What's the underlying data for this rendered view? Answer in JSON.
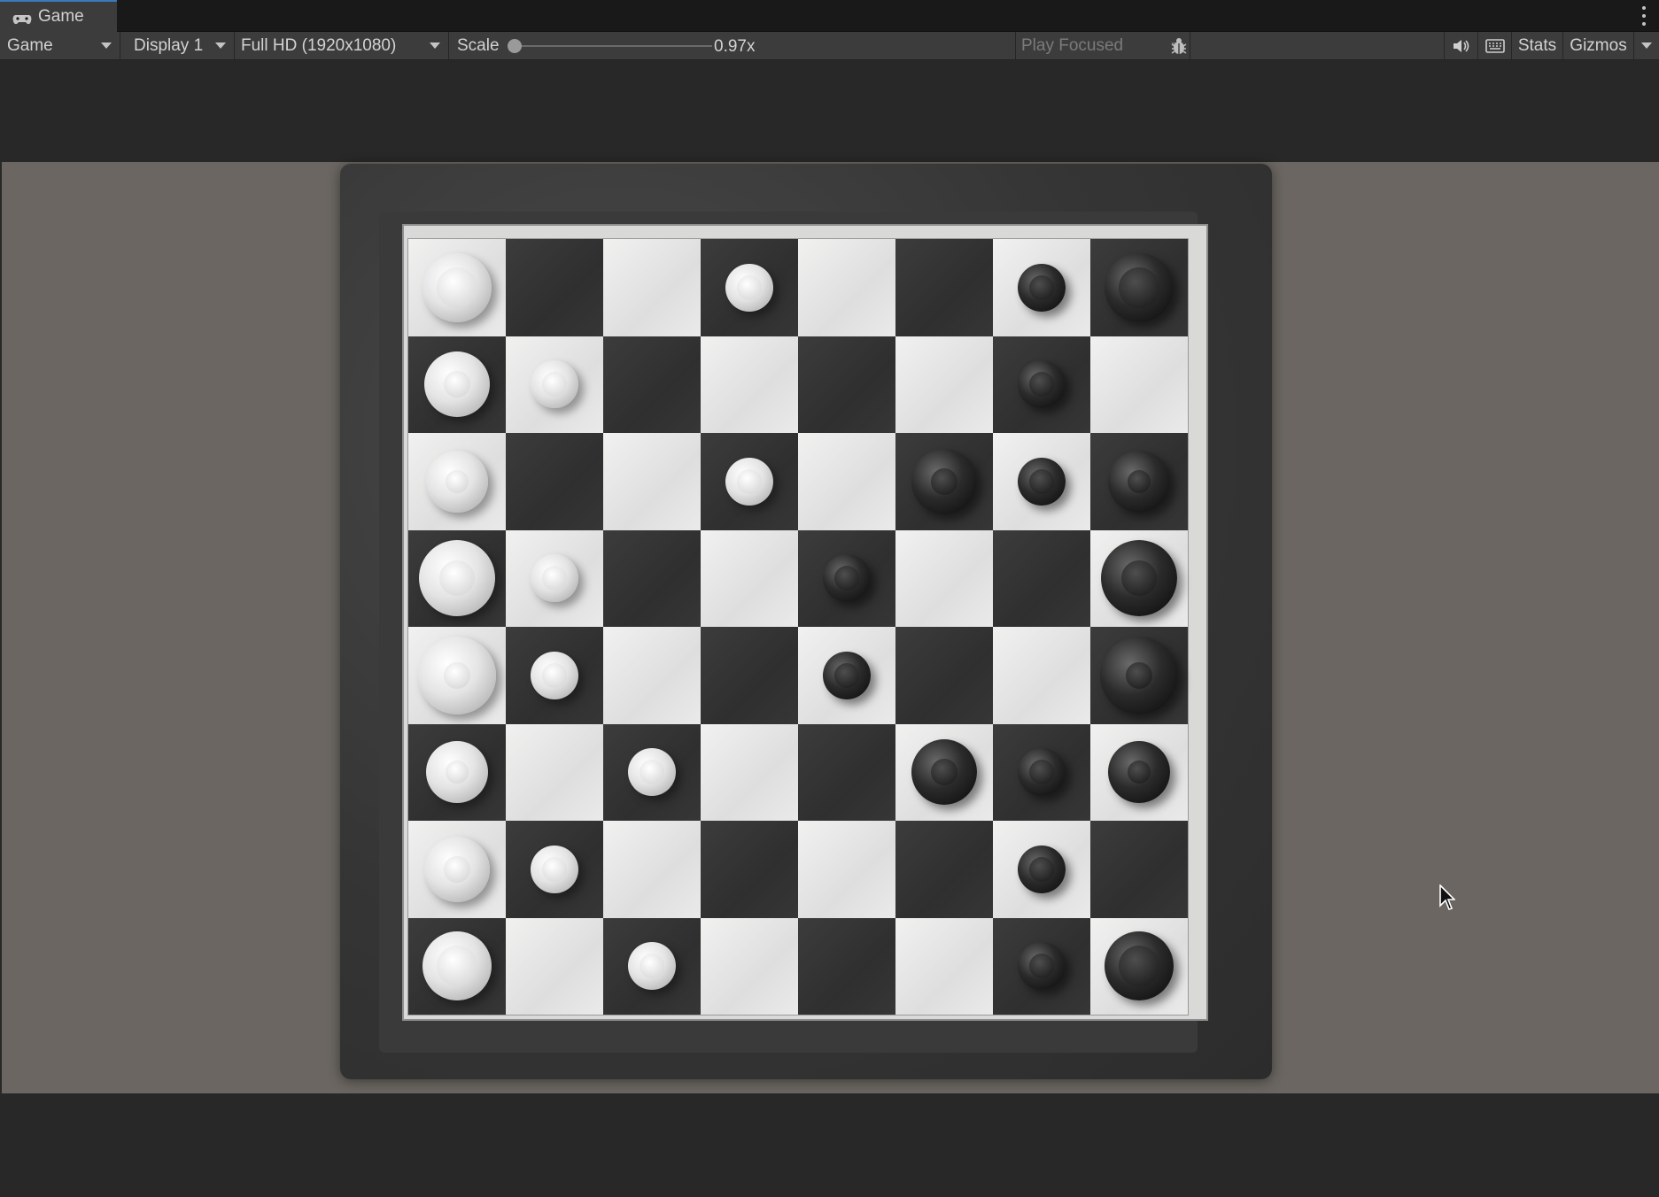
{
  "tab": {
    "label": "Game"
  },
  "toolbar": {
    "view_mode": "Game",
    "display": "Display 1",
    "resolution": "Full HD (1920x1080)",
    "scale_label": "Scale",
    "scale_value": "0.97x",
    "scale_level": 0.0,
    "play_mode": "Play Focused",
    "stats_label": "Stats",
    "gizmos_label": "Gizmos"
  },
  "icons": {
    "tab_icon": "gamepad-icon",
    "bug": "bug-icon",
    "audio": "speaker-icon",
    "keyboard": "keyboard-icon",
    "menu": "kebab-menu-icon",
    "cursor": "mouse-pointer-icon"
  },
  "colors": {
    "editor_bg": "#282828",
    "toolbar_bg": "#3c3c3c",
    "tab_accent": "#3a79bb",
    "viewport_bg": "#6b6661"
  },
  "game": {
    "pieces": [
      {
        "type": "rook",
        "color": "white",
        "col": 0,
        "row": 0
      },
      {
        "type": "knight",
        "color": "white",
        "col": 0,
        "row": 1
      },
      {
        "type": "bishop",
        "color": "white",
        "col": 0,
        "row": 2
      },
      {
        "type": "queen",
        "color": "white",
        "col": 0,
        "row": 3
      },
      {
        "type": "king",
        "color": "white",
        "col": 0,
        "row": 4
      },
      {
        "type": "bishop",
        "color": "white",
        "col": 0,
        "row": 5
      },
      {
        "type": "knight",
        "color": "white",
        "col": 0,
        "row": 6
      },
      {
        "type": "rook",
        "color": "white",
        "col": 0,
        "row": 7
      },
      {
        "type": "pawn",
        "color": "white",
        "col": 1,
        "row": 1
      },
      {
        "type": "pawn",
        "color": "white",
        "col": 1,
        "row": 3
      },
      {
        "type": "pawn",
        "color": "white",
        "col": 1,
        "row": 4
      },
      {
        "type": "pawn",
        "color": "white",
        "col": 1,
        "row": 6
      },
      {
        "type": "pawn",
        "color": "white",
        "col": 2,
        "row": 5
      },
      {
        "type": "pawn",
        "color": "white",
        "col": 2,
        "row": 7
      },
      {
        "type": "pawn",
        "color": "white",
        "col": 3,
        "row": 0
      },
      {
        "type": "pawn",
        "color": "white",
        "col": 3,
        "row": 2
      },
      {
        "type": "pawn",
        "color": "black",
        "col": 4,
        "row": 3
      },
      {
        "type": "pawn",
        "color": "black",
        "col": 4,
        "row": 4
      },
      {
        "type": "knight",
        "color": "black",
        "col": 5,
        "row": 2
      },
      {
        "type": "knight",
        "color": "black",
        "col": 5,
        "row": 5
      },
      {
        "type": "pawn",
        "color": "black",
        "col": 6,
        "row": 0
      },
      {
        "type": "pawn",
        "color": "black",
        "col": 6,
        "row": 1
      },
      {
        "type": "pawn",
        "color": "black",
        "col": 6,
        "row": 2
      },
      {
        "type": "pawn",
        "color": "black",
        "col": 6,
        "row": 5
      },
      {
        "type": "pawn",
        "color": "black",
        "col": 6,
        "row": 6
      },
      {
        "type": "pawn",
        "color": "black",
        "col": 6,
        "row": 7
      },
      {
        "type": "rook",
        "color": "black",
        "col": 7,
        "row": 0
      },
      {
        "type": "bishop",
        "color": "black",
        "col": 7,
        "row": 2
      },
      {
        "type": "queen",
        "color": "black",
        "col": 7,
        "row": 3
      },
      {
        "type": "king",
        "color": "black",
        "col": 7,
        "row": 4
      },
      {
        "type": "bishop",
        "color": "black",
        "col": 7,
        "row": 5
      },
      {
        "type": "rook",
        "color": "black",
        "col": 7,
        "row": 7
      }
    ]
  }
}
